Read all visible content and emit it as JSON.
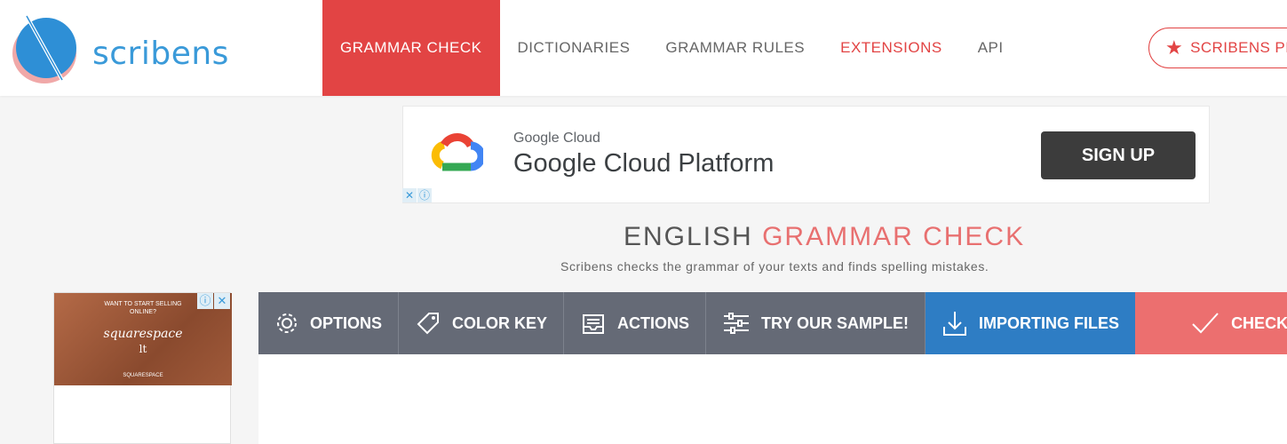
{
  "brand": {
    "name": "scribens"
  },
  "nav": {
    "items": [
      {
        "label": "GRAMMAR CHECK",
        "active": true
      },
      {
        "label": "DICTIONARIES"
      },
      {
        "label": "GRAMMAR RULES"
      },
      {
        "label": "EXTENSIONS",
        "accent": true
      },
      {
        "label": "API"
      }
    ],
    "premium_label": "SCRIBENS PI"
  },
  "ad": {
    "brand_small": "Google Cloud",
    "title": "Google Cloud Platform",
    "cta": "SIGN UP",
    "close_glyph": "✕",
    "info_glyph": "ⓘ"
  },
  "heading": {
    "part1": "ENGLISH",
    "part2": "GRAMMAR CHECK",
    "subtitle": "Scribens checks the grammar of your texts and finds spelling mistakes."
  },
  "side_ad": {
    "top_text": "WANT TO START SELLING ONLINE?",
    "brand": "squarespace",
    "sub": "lt",
    "foot": "SQUARESPACE"
  },
  "toolbar": {
    "options": "OPTIONS",
    "color_key": "COLOR KEY",
    "actions": "ACTIONS",
    "sample": "TRY OUR SAMPLE!",
    "importing": "IMPORTING FILES",
    "check": "CHECK"
  },
  "colors": {
    "accent_red": "#e24444",
    "brand_blue": "#3a9ad9",
    "toolbar_gray": "#656a76",
    "import_blue": "#2e7dc4",
    "check_red": "#ec6f6f"
  }
}
